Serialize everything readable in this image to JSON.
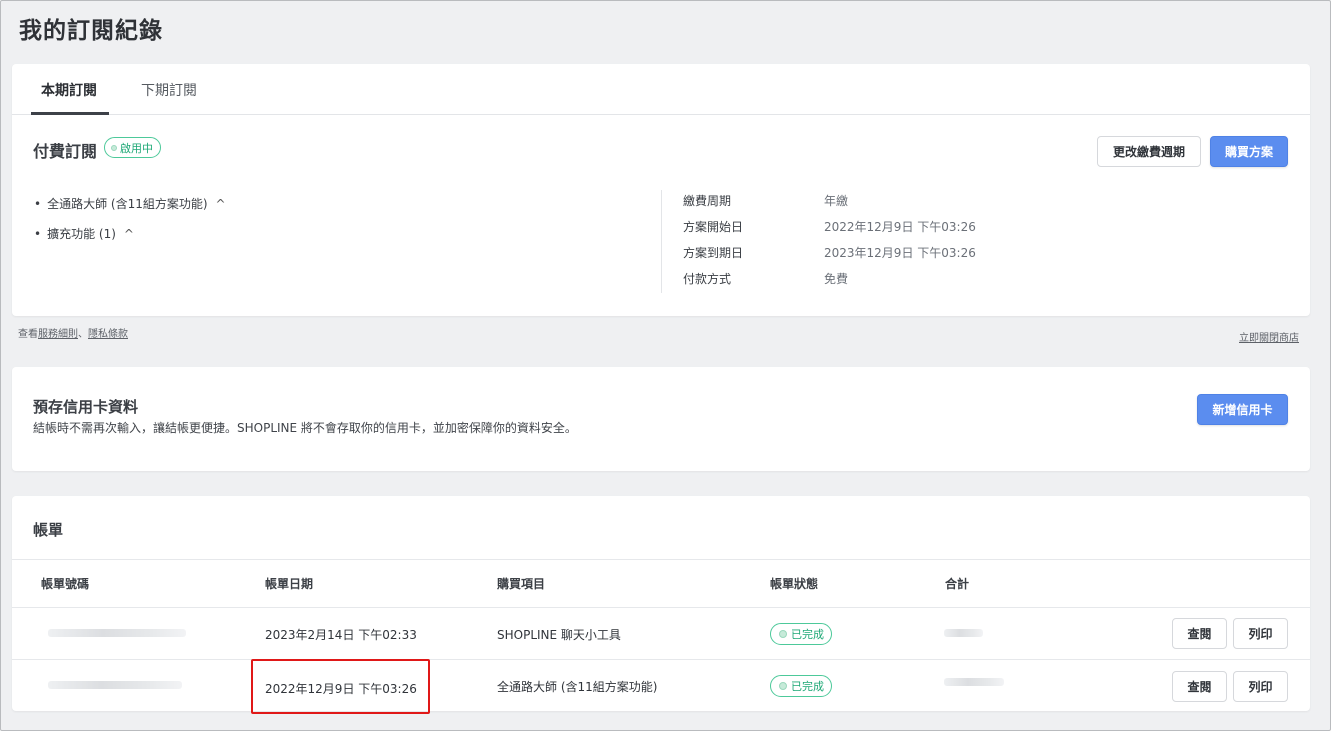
{
  "page": {
    "title": "我的訂閱紀錄"
  },
  "subscription": {
    "tabs": [
      {
        "label": "本期訂閱"
      },
      {
        "label": "下期訂閱"
      }
    ],
    "title": "付費訂閱",
    "badge": "啟用中",
    "change_period_button": "更改繳費週期",
    "buy_plan_button": "購買方案",
    "features": [
      {
        "label": "全通路大師 (含11組方案功能)"
      },
      {
        "label": "擴充功能 (1)"
      }
    ],
    "info": [
      {
        "label": "繳費周期",
        "value": "年繳"
      },
      {
        "label": "方案開始日",
        "value": "2022年12月9日 下午03:26"
      },
      {
        "label": "方案到期日",
        "value": "2023年12月9日 下午03:26"
      },
      {
        "label": "付款方式",
        "value": "免費"
      }
    ]
  },
  "footer": {
    "prefix": "查看",
    "terms": "服務細則",
    "separator": "、",
    "privacy": "隱私條款",
    "close_store": "立即關閉商店"
  },
  "credit_card": {
    "title": "預存信用卡資料",
    "description": "結帳時不需再次輸入，讓結帳更便捷。SHOPLINE 將不會存取你的信用卡，並加密保障你的資料安全。",
    "add_button": "新增信用卡"
  },
  "bills": {
    "title": "帳單",
    "columns": [
      "帳單號碼",
      "帳單日期",
      "購買項目",
      "帳單狀態",
      "合計"
    ],
    "rows": [
      {
        "date": "2023年2月14日 下午02:33",
        "item": "SHOPLINE 聊天小工具",
        "status": "已完成",
        "view": "查閱",
        "print": "列印"
      },
      {
        "date": "2022年12月9日 下午03:26",
        "item": "全通路大師 (含11組方案功能)",
        "status": "已完成",
        "view": "查閱",
        "print": "列印"
      }
    ]
  },
  "colors": {
    "primary": "#5b8def",
    "success": "#1ea876",
    "highlight": "#e01818",
    "background": "#eff0f2"
  }
}
